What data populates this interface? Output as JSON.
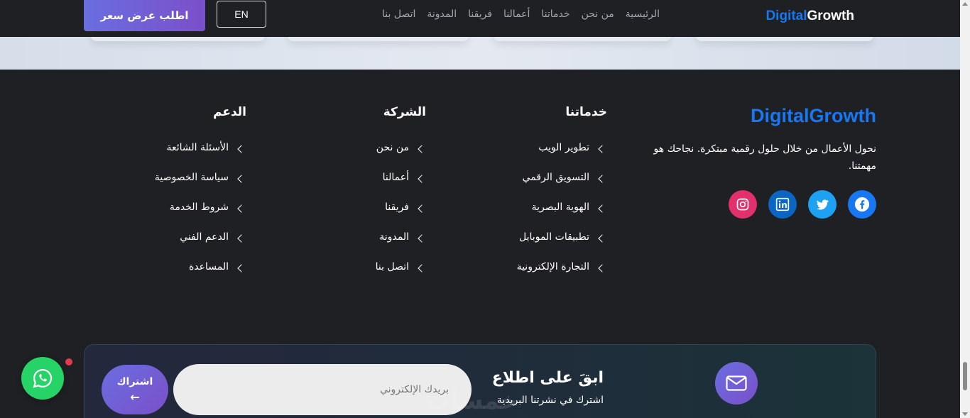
{
  "header": {
    "logo_part1": "Digital",
    "logo_part2": "Growth",
    "nav": [
      "الرئيسية",
      "من نحن",
      "خدماتنا",
      "أعمالنا",
      "فريقنا",
      "المدونة",
      "اتصل بنا"
    ],
    "lang_label": "EN",
    "quote_label": "اطلب عرض سعر"
  },
  "footer": {
    "brand": {
      "title": "DigitalGrowth",
      "description": "نحول الأعمال من خلال حلول رقمية مبتكرة. نجاحك هو مهمتنا."
    },
    "socials": [
      {
        "icon": "facebook-icon",
        "color": "#1877f2"
      },
      {
        "icon": "twitter-icon",
        "color": "#1da1f2"
      },
      {
        "icon": "linkedin-icon",
        "color": "#0a66c2"
      },
      {
        "icon": "instagram-icon",
        "color": "#e1306c"
      }
    ],
    "services": {
      "title": "خدماتنا",
      "items": [
        "تطوير الويب",
        "التسويق الرقمي",
        "الهوية البصرية",
        "تطبيقات الموبايل",
        "التجارة الإلكترونية"
      ]
    },
    "company": {
      "title": "الشركة",
      "items": [
        "من نحن",
        "أعمالنا",
        "فريقنا",
        "المدونة",
        "اتصل بنا"
      ]
    },
    "support": {
      "title": "الدعم",
      "items": [
        "الأسئلة الشائعة",
        "سياسة الخصوصية",
        "شروط الخدمة",
        "الدعم الفني",
        "المساعدة"
      ]
    },
    "newsletter": {
      "title": "ابقَ على اطلاع",
      "subtitle": "اشترك في نشرتنا البريدية",
      "placeholder": "بريدك الإلكتروني",
      "button_label": "اشتراك",
      "button_arrow": "←"
    }
  },
  "watermark": "خمسات",
  "colors": {
    "accent": "#1877f2",
    "purple": "#7b4fc9",
    "whatsapp": "#25d366",
    "background": "#1f2024"
  }
}
